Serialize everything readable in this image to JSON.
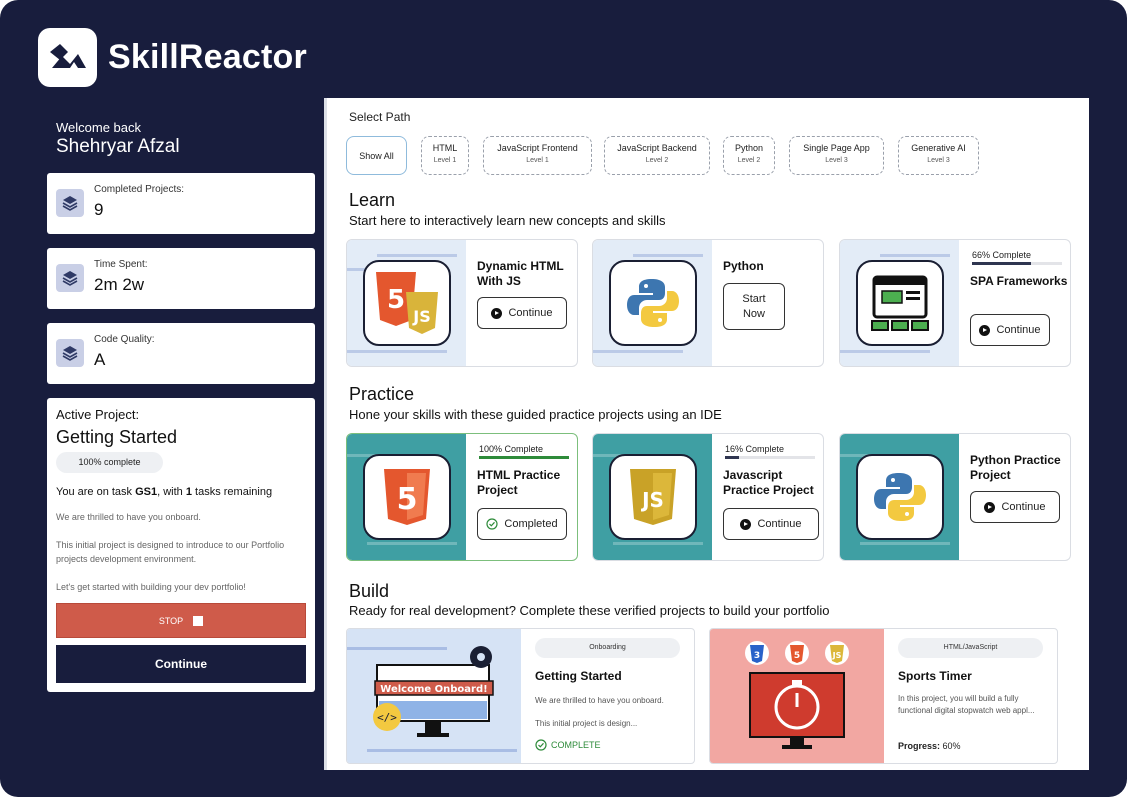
{
  "brand": {
    "name": "SkillReactor"
  },
  "sidebar": {
    "welcome": "Welcome back",
    "user_name": "Shehryar Afzal",
    "stats": [
      {
        "label": "Completed Projects:",
        "value": "9"
      },
      {
        "label": "Time Spent:",
        "value": "2m 2w"
      },
      {
        "label": "Code Quality:",
        "value": "A"
      }
    ],
    "active_project": {
      "label": "Active Project:",
      "title": "Getting Started",
      "progress": "100% complete",
      "task_prefix": "You are on task ",
      "task_id": "GS1",
      "task_mid": ", with ",
      "task_count": "1",
      "task_suffix": " tasks remaining",
      "para1": "We are thrilled to have you onboard.",
      "para2": "This initial project is designed to introduce to our Portfolio projects development environment.",
      "para3": "Let's get started with building your dev portfolio!",
      "stop_label": "STOP",
      "continue_label": "Continue"
    }
  },
  "main": {
    "select_path": "Select Path",
    "chips": [
      {
        "name": "Show All",
        "level": ""
      },
      {
        "name": "HTML",
        "level": "Level 1"
      },
      {
        "name": "JavaScript Frontend",
        "level": "Level 1"
      },
      {
        "name": "JavaScript Backend",
        "level": "Level 2"
      },
      {
        "name": "Python",
        "level": "Level 2"
      },
      {
        "name": "Single Page App",
        "level": "Level 3"
      },
      {
        "name": "Generative AI",
        "level": "Level 3"
      }
    ],
    "learn": {
      "title": "Learn",
      "subtitle": "Start here to interactively learn new concepts and skills",
      "cards": [
        {
          "title": "Dynamic HTML With JS",
          "button": "Continue"
        },
        {
          "title": "Python",
          "button": "Start Now"
        },
        {
          "title": "SPA Frameworks",
          "button": "Continue",
          "progress_text": "66% Complete",
          "progress": 0.66
        }
      ]
    },
    "practice": {
      "title": "Practice",
      "subtitle": "Hone your skills with these guided practice projects using an IDE",
      "cards": [
        {
          "title": "HTML Practice Project",
          "button": "Completed",
          "progress_text": "100% Complete",
          "progress": 1.0
        },
        {
          "title": "Javascript Practice Project",
          "button": "Continue",
          "progress_text": "16% Complete",
          "progress": 0.16
        },
        {
          "title": "Python Practice Project",
          "button": "Continue"
        }
      ]
    },
    "build": {
      "title": "Build",
      "subtitle": "Ready for real development? Complete these verified projects to build your portfolio",
      "cards": [
        {
          "tag": "Onboarding",
          "title": "Getting Started",
          "desc1": "We are thrilled to have you onboard.",
          "desc2": "This initial project is design...",
          "status": "COMPLETE",
          "banner": "Welcome Onboard!"
        },
        {
          "tag": "HTML/JavaScript",
          "title": "Sports Timer",
          "desc1": "In this project, you will build a fully functional digital stopwatch web appl...",
          "progress_label": "Progress:",
          "progress_value": " 60%",
          "badges": [
            "3",
            "5",
            "JS"
          ]
        }
      ]
    }
  },
  "colors": {
    "navy": "#181d3d",
    "stop_red": "#cf5b4a",
    "complete_green": "#2e8b3a",
    "teal": "#3f9fa3"
  }
}
